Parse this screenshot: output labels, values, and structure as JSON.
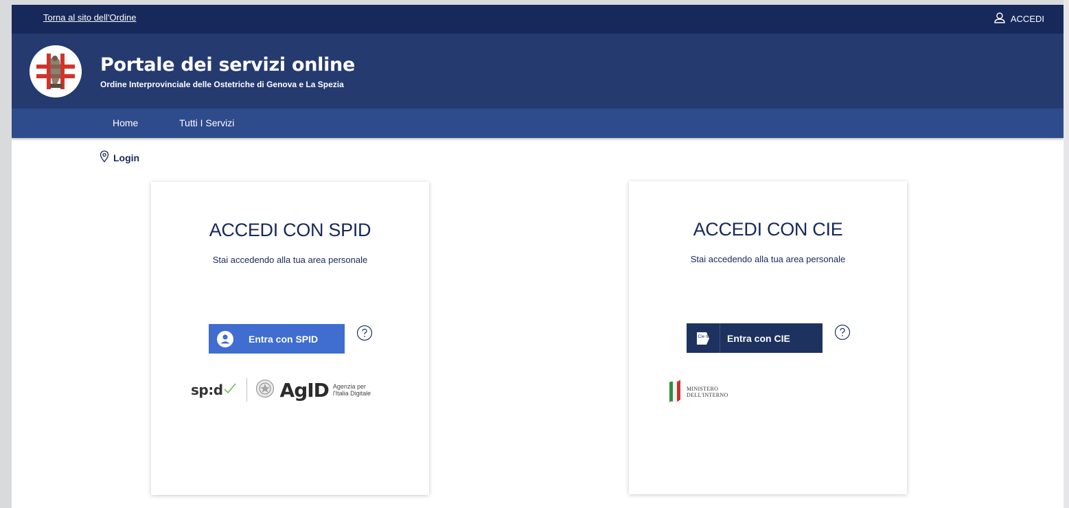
{
  "topbar": {
    "back_link": "Torna al sito dell'Ordine",
    "login_label": "ACCEDI"
  },
  "header": {
    "title": "Portale dei servizi online",
    "subtitle": "Ordine Interprovinciale delle Ostetriche di Genova e La Spezia"
  },
  "nav": {
    "items": [
      {
        "label": "Home"
      },
      {
        "label": "Tutti I Servizi"
      }
    ]
  },
  "breadcrumb": {
    "current": "Login"
  },
  "spid_card": {
    "title": "ACCEDI CON SPID",
    "subtitle": "Stai accedendo alla tua area personale",
    "button_label": "Entra con SPID",
    "logo_spid": "sp:d",
    "logo_agid": "AgID",
    "agid_caption_line1": "Agenzia per",
    "agid_caption_line2": "l'Italia Digitale"
  },
  "cie_card": {
    "title": "ACCEDI CON CIE",
    "subtitle": "Stai accedendo alla tua area personale",
    "button_label": "Entra con CIE",
    "icon_text": "Cie ID",
    "ministry_line1": "MINISTERO",
    "ministry_line2": "DELL'INTERNO"
  },
  "colors": {
    "topbar": "#17285a",
    "header": "#253a6f",
    "nav": "#2e4b8c",
    "spid_button": "#3f6dd0",
    "cie_button": "#1e3260",
    "text_dark": "#17285a"
  },
  "icons": {
    "user": "user-icon",
    "location": "map-pin-icon",
    "help": "help-circle-icon",
    "spid_user": "spid-user-icon",
    "cie": "cie-id-icon"
  }
}
